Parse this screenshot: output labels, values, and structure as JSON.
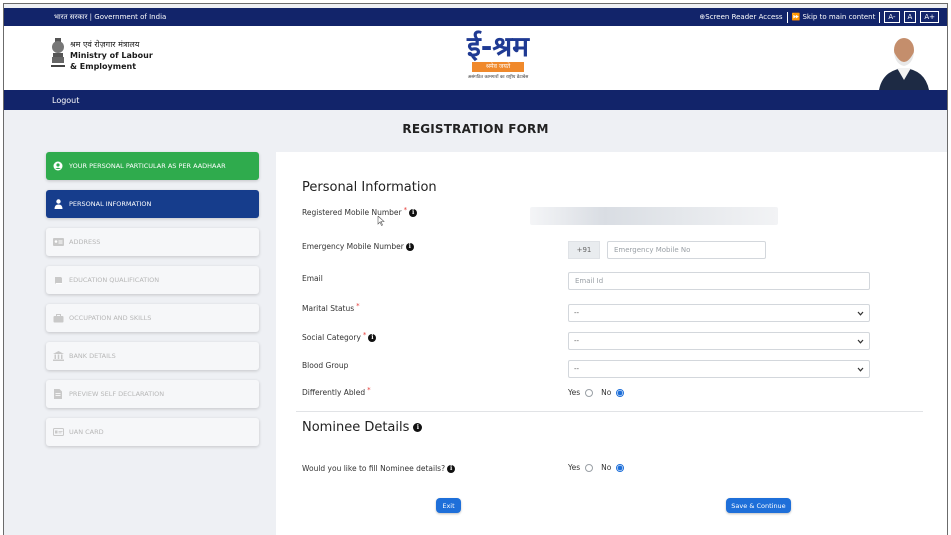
{
  "topbar": {
    "gov_label": "भारत सरकार | Government of India",
    "screen_reader": "⊕Screen Reader Access",
    "skip_main": "⏩ Skip to main content",
    "font_small": "A-",
    "font_normal": "A",
    "font_large": "A+"
  },
  "header": {
    "ministry_hi": "श्रम एवं रोज़गार मंत्रालय",
    "ministry_en_1": "Ministry of Labour",
    "ministry_en_2": "& Employment",
    "logo_text": "ई-श्रम",
    "logo_band": "श्रमेव जयते",
    "logo_tag": "असंगठित कामगारों का राष्ट्रीय डेटाबेस"
  },
  "nav": {
    "logout": "Logout"
  },
  "page": {
    "title": "REGISTRATION FORM"
  },
  "sidebar": {
    "items": [
      {
        "label": "YOUR PERSONAL PARTICULAR AS PER AADHAAR",
        "icon": "user-circle-icon",
        "state": "done"
      },
      {
        "label": "PERSONAL INFORMATION",
        "icon": "person-icon",
        "state": "active"
      },
      {
        "label": "ADDRESS",
        "icon": "address-card-icon",
        "state": "disabled"
      },
      {
        "label": "EDUCATION QUALIFICATION",
        "icon": "book-icon",
        "state": "disabled"
      },
      {
        "label": "OCCUPATION AND SKILLS",
        "icon": "briefcase-icon",
        "state": "disabled"
      },
      {
        "label": "BANK DETAILS",
        "icon": "bank-icon",
        "state": "disabled"
      },
      {
        "label": "PREVIEW SELF DECLARATION",
        "icon": "document-icon",
        "state": "disabled"
      },
      {
        "label": "UAN CARD",
        "icon": "id-card-icon",
        "state": "disabled"
      }
    ]
  },
  "form": {
    "section_title": "Personal Information",
    "registered_mobile_label": "Registered Mobile Number",
    "emergency_mobile_label": "Emergency Mobile Number",
    "country_code": "+91",
    "emergency_placeholder": "Emergency Mobile No",
    "email_label": "Email",
    "email_placeholder": "Email Id",
    "marital_label": "Marital Status",
    "marital_value": "--",
    "social_label": "Social Category",
    "social_value": "--",
    "blood_label": "Blood Group",
    "blood_value": "--",
    "disabled_label": "Differently Abled",
    "yes": "Yes",
    "no": "No",
    "nominee_title": "Nominee Details",
    "nominee_question": "Would you like to fill Nominee details?",
    "exit": "Exit",
    "save": "Save & Continue"
  },
  "colors": {
    "navy": "#12246a",
    "green_step": "#2fab4d",
    "active_step": "#163d8c",
    "button_blue": "#1e6fd9"
  }
}
